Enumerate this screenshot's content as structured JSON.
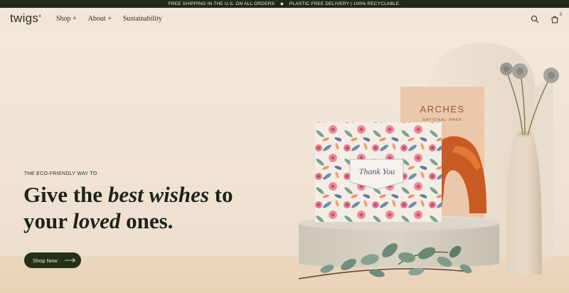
{
  "announcement": {
    "left": "FREE SHIPPING IN THE U.S. ON ALL ORDERS",
    "separator": "◆",
    "right": "PLASTIC FREE DELIVERY | 100% RECYCLABLE."
  },
  "header": {
    "logo": "twigs",
    "logo_mark": "®",
    "nav": [
      {
        "label": "Shop +"
      },
      {
        "label": "About +"
      },
      {
        "label": "Sustainability"
      }
    ],
    "cart_count": "0"
  },
  "hero": {
    "eyebrow": "THE ECO-FRIENDLY WAY TO",
    "line1_a": "Give the ",
    "line1_em": "best wishes",
    "line1_b": " to",
    "line2_a": "your ",
    "line2_em": "loved",
    "line2_b": " ones.",
    "cta_label": "Shop Now"
  },
  "cards": {
    "thank_you": "Thank You",
    "arches_title": "ARCHES",
    "arches_subtitle": "NATIONAL PARK"
  },
  "colors": {
    "announcement_bg": "#1f2b18",
    "cta_bg": "#23301a",
    "background": "#f2e6d8"
  }
}
